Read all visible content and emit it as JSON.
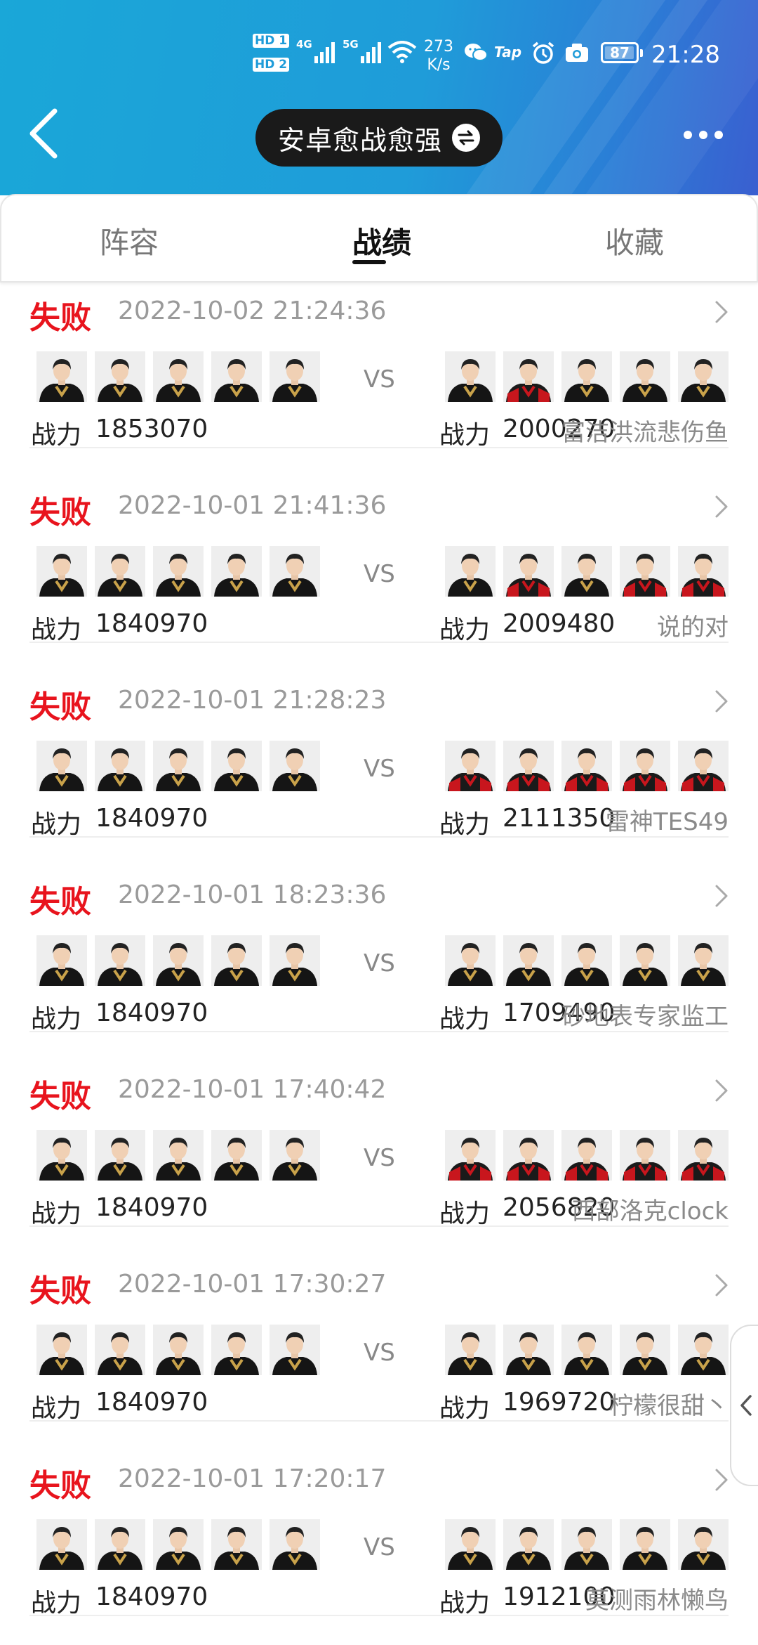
{
  "status_bar": {
    "hd1": "HD 1",
    "hd2": "HD 2",
    "net_4g": "4G",
    "net_5g": "5G",
    "speed_value": "273",
    "speed_unit": "K/s",
    "app_tap": "Tap",
    "battery": "87",
    "time": "21:28"
  },
  "header": {
    "title": "安卓愈战愈强",
    "icons": [
      "back-arrow-icon",
      "swap-icon",
      "more-icon"
    ]
  },
  "tabs": [
    {
      "label": "阵容",
      "active": false
    },
    {
      "label": "战绩",
      "active": true
    },
    {
      "label": "收藏",
      "active": false
    }
  ],
  "power_label": "战力",
  "vs_label": "VS",
  "colors": {
    "loss": "#e8141d",
    "accent": "#1f9cd9"
  },
  "matches": [
    {
      "result": "失败",
      "datetime": "2022-10-02 21:24:36",
      "my_power": "1853070",
      "opp_power": "2000270",
      "opp_name": "富洁洪流悲伤鱼",
      "opp_jerseys": [
        "black",
        "red",
        "black",
        "black",
        "black"
      ]
    },
    {
      "result": "失败",
      "datetime": "2022-10-01 21:41:36",
      "my_power": "1840970",
      "opp_power": "2009480",
      "opp_name": "说的对",
      "opp_jerseys": [
        "black",
        "red",
        "black",
        "red",
        "red"
      ]
    },
    {
      "result": "失败",
      "datetime": "2022-10-01 21:28:23",
      "my_power": "1840970",
      "opp_power": "2111350",
      "opp_name": "雷神TES49",
      "opp_jerseys": [
        "red",
        "red",
        "red",
        "red",
        "red"
      ]
    },
    {
      "result": "失败",
      "datetime": "2022-10-01 18:23:36",
      "my_power": "1840970",
      "opp_power": "1709490",
      "opp_name": "砂地表专家监工",
      "opp_jerseys": [
        "black",
        "black",
        "black",
        "black",
        "black"
      ]
    },
    {
      "result": "失败",
      "datetime": "2022-10-01 17:40:42",
      "my_power": "1840970",
      "opp_power": "2056820",
      "opp_name": "西部洛克clock",
      "opp_jerseys": [
        "red",
        "red",
        "red",
        "red",
        "red"
      ]
    },
    {
      "result": "失败",
      "datetime": "2022-10-01 17:30:27",
      "my_power": "1840970",
      "opp_power": "1969720",
      "opp_name": "柠檬很甜丶",
      "opp_jerseys": [
        "black",
        "black",
        "black",
        "black",
        "black"
      ]
    },
    {
      "result": "失败",
      "datetime": "2022-10-01 17:20:17",
      "my_power": "1840970",
      "opp_power": "1912100",
      "opp_name": "莫测雨林懒鸟",
      "opp_jerseys": [
        "black",
        "black",
        "black",
        "black",
        "black"
      ]
    }
  ]
}
